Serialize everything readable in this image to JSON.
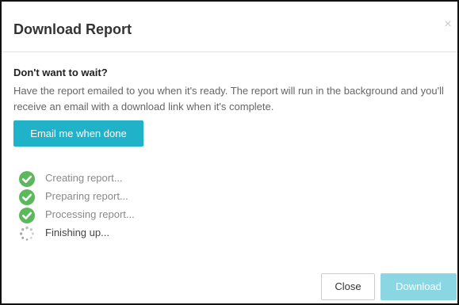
{
  "dialog": {
    "title": "Download Report",
    "close_glyph": "×",
    "close_icon": "close-icon"
  },
  "wait_section": {
    "heading": "Don't want to wait?",
    "description": "Have the report emailed to you when it's ready. The report will run in the background and you'll receive an email with a download link when it's complete.",
    "email_button_label": "Email me when done"
  },
  "progress": {
    "steps": [
      {
        "label": "Creating report...",
        "status": "done",
        "icon": "check-circle-icon"
      },
      {
        "label": "Preparing report...",
        "status": "done",
        "icon": "check-circle-icon"
      },
      {
        "label": "Processing report...",
        "status": "done",
        "icon": "check-circle-icon"
      },
      {
        "label": "Finishing up...",
        "status": "in-progress",
        "icon": "spinner-icon"
      }
    ]
  },
  "footer": {
    "close_label": "Close",
    "download_label": "Download",
    "download_enabled": false
  },
  "colors": {
    "accent": "#1fb2c9",
    "accent_disabled": "#8ad6e2",
    "check_green": "#5cb85c",
    "title_text": "#333333",
    "muted_text": "#8a8a8a"
  }
}
